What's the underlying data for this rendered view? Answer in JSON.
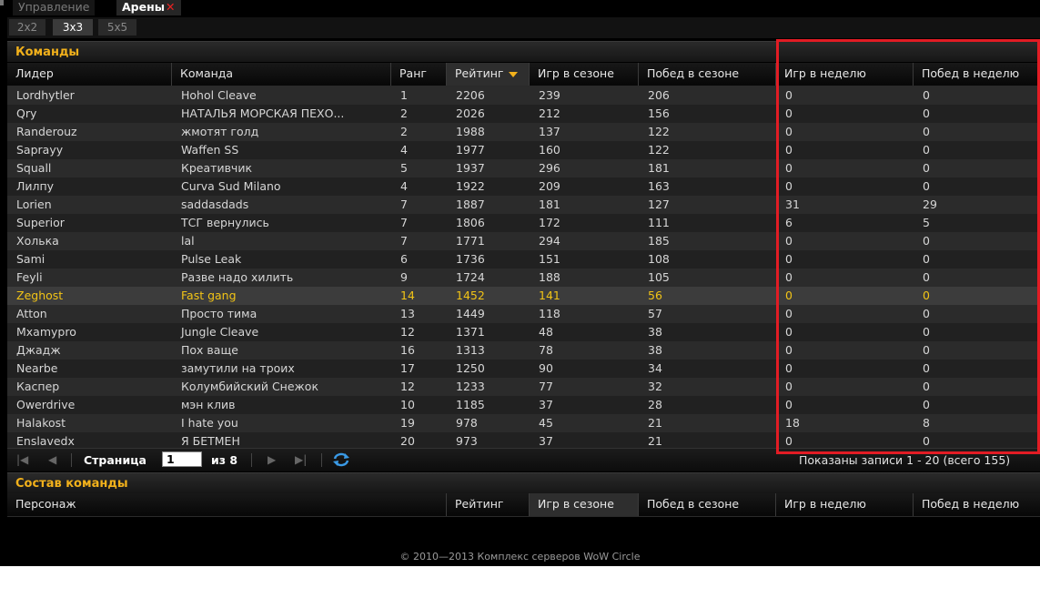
{
  "top_tabs": {
    "manage": "Управление",
    "arenas": "Арены",
    "close": "✕"
  },
  "sub_tabs": [
    "2x2",
    "3x3",
    "5x5"
  ],
  "teams_panel": {
    "title": "Команды"
  },
  "columns": [
    "Лидер",
    "Команда",
    "Ранг",
    "Рейтинг",
    "Игр в сезоне",
    "Побед в сезоне",
    "Игр в неделю",
    "Побед в неделю"
  ],
  "rows": [
    [
      "Lordhytler",
      "Hohol Cleave",
      "1",
      "2206",
      "239",
      "206",
      "0",
      "0"
    ],
    [
      "Qry",
      "НАТАЛЬЯ МОРСКАЯ ПЕХО...",
      "2",
      "2026",
      "212",
      "156",
      "0",
      "0"
    ],
    [
      "Randerouz",
      "жмотят голд",
      "2",
      "1988",
      "137",
      "122",
      "0",
      "0"
    ],
    [
      "Saprayy",
      "Waffen SS",
      "4",
      "1977",
      "160",
      "122",
      "0",
      "0"
    ],
    [
      "Squall",
      "Креативчик",
      "5",
      "1937",
      "296",
      "181",
      "0",
      "0"
    ],
    [
      "Лилпу",
      "Curva Sud Milano",
      "4",
      "1922",
      "209",
      "163",
      "0",
      "0"
    ],
    [
      "Lorien",
      "saddasdads",
      "7",
      "1887",
      "181",
      "127",
      "31",
      "29"
    ],
    [
      "Superior",
      "ТСГ вернулись",
      "7",
      "1806",
      "172",
      "111",
      "6",
      "5"
    ],
    [
      "Холька",
      "lal",
      "7",
      "1771",
      "294",
      "185",
      "0",
      "0"
    ],
    [
      "Sami",
      "Pulse Leak",
      "6",
      "1736",
      "151",
      "108",
      "0",
      "0"
    ],
    [
      "Feyli",
      "Разве надо хилить",
      "9",
      "1724",
      "188",
      "105",
      "0",
      "0"
    ],
    [
      "Zeghost",
      "Fast gang",
      "14",
      "1452",
      "141",
      "56",
      "0",
      "0"
    ],
    [
      "Atton",
      "Просто тима",
      "13",
      "1449",
      "118",
      "57",
      "0",
      "0"
    ],
    [
      "Mxamypro",
      "Jungle Cleave",
      "12",
      "1371",
      "48",
      "38",
      "0",
      "0"
    ],
    [
      "Джадж",
      "Пох ваще",
      "16",
      "1313",
      "78",
      "38",
      "0",
      "0"
    ],
    [
      "Nearbe",
      "замутили на троих",
      "17",
      "1250",
      "90",
      "34",
      "0",
      "0"
    ],
    [
      "Каспер",
      "Колумбийский Снежок",
      "12",
      "1233",
      "77",
      "32",
      "0",
      "0"
    ],
    [
      "Owerdrive",
      "мэн клив",
      "10",
      "1185",
      "37",
      "28",
      "0",
      "0"
    ],
    [
      "Halakost",
      "I hate you",
      "19",
      "978",
      "45",
      "21",
      "18",
      "8"
    ],
    [
      "Enslavedx",
      "Я БЕТМЕН",
      "20",
      "973",
      "37",
      "21",
      "0",
      "0"
    ]
  ],
  "selected_row": 11,
  "pager": {
    "page_label": "Страница",
    "page_value": "1",
    "of_label": "из 8",
    "status": "Показаны записи 1 - 20 (всего 155)"
  },
  "composition_panel": {
    "title": "Состав команды"
  },
  "composition_columns": [
    "Персонаж",
    "Рейтинг",
    "Игр в сезоне",
    "Побед в сезоне",
    "Игр в неделю",
    "Побед в неделю"
  ],
  "footer": "© 2010—2013 Комплекс серверов WoW Circle",
  "colors": {
    "accent": "#f2b11b",
    "highlight_box": "#e21c24",
    "selected_text": "#f2c416"
  }
}
